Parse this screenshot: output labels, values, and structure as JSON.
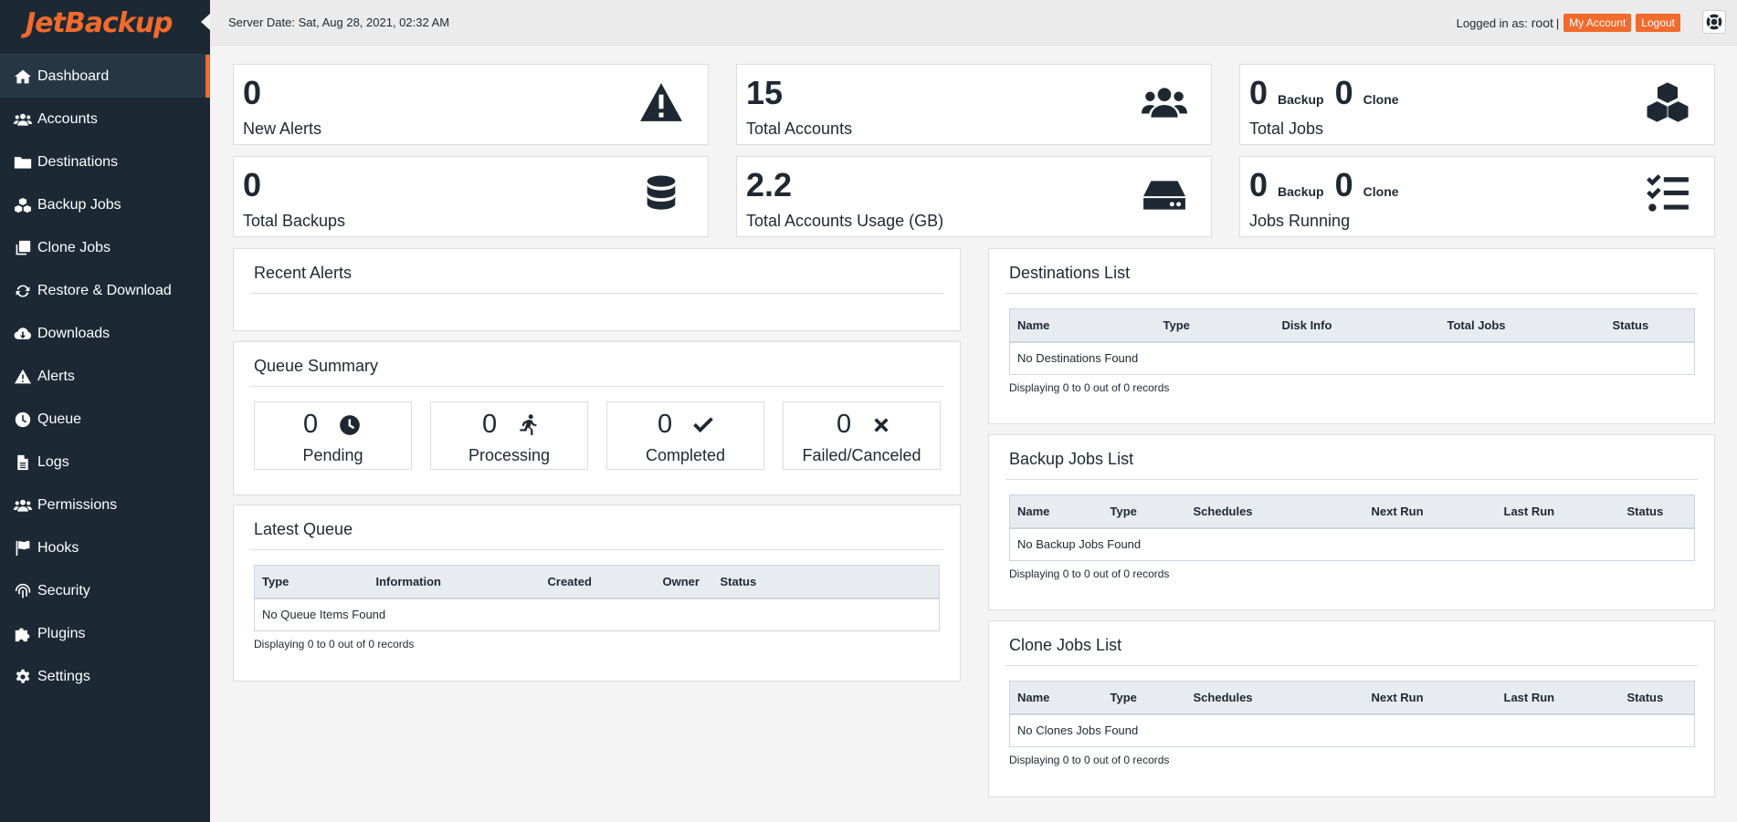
{
  "brand": {
    "logo": "JetBackup",
    "accent": "#f26b2c"
  },
  "sidebar": {
    "items": [
      {
        "label": "Dashboard",
        "icon": "home-icon",
        "active": true
      },
      {
        "label": "Accounts",
        "icon": "users-icon"
      },
      {
        "label": "Destinations",
        "icon": "folder-icon"
      },
      {
        "label": "Backup Jobs",
        "icon": "cubes-icon"
      },
      {
        "label": "Clone Jobs",
        "icon": "copy-icon"
      },
      {
        "label": "Restore & Download",
        "icon": "sync-icon"
      },
      {
        "label": "Downloads",
        "icon": "cloud-download-icon"
      },
      {
        "label": "Alerts",
        "icon": "warning-icon"
      },
      {
        "label": "Queue",
        "icon": "clock-icon"
      },
      {
        "label": "Logs",
        "icon": "file-icon"
      },
      {
        "label": "Permissions",
        "icon": "users-icon"
      },
      {
        "label": "Hooks",
        "icon": "flag-icon"
      },
      {
        "label": "Security",
        "icon": "fingerprint-icon"
      },
      {
        "label": "Plugins",
        "icon": "puzzle-icon"
      },
      {
        "label": "Settings",
        "icon": "gear-icon"
      }
    ]
  },
  "topbar": {
    "server_date": "Server Date: Sat, Aug 28, 2021, 02:32 AM",
    "logged_in_prefix": "Logged in as:",
    "user": "root",
    "separator": "|",
    "my_account": "My Account",
    "logout": "Logout"
  },
  "stats": {
    "new_alerts": {
      "value": "0",
      "label": "New Alerts"
    },
    "total_accounts": {
      "value": "15",
      "label": "Total Accounts"
    },
    "total_jobs": {
      "backup_value": "0",
      "backup_label": "Backup",
      "clone_value": "0",
      "clone_label": "Clone",
      "label": "Total Jobs"
    },
    "total_backups": {
      "value": "0",
      "label": "Total Backups"
    },
    "accounts_usage": {
      "value": "2.2",
      "label": "Total Accounts Usage (GB)"
    },
    "jobs_running": {
      "backup_value": "0",
      "backup_label": "Backup",
      "clone_value": "0",
      "clone_label": "Clone",
      "label": "Jobs Running"
    }
  },
  "recent_alerts": {
    "title": "Recent Alerts"
  },
  "queue_summary": {
    "title": "Queue Summary",
    "pending": {
      "value": "0",
      "label": "Pending"
    },
    "processing": {
      "value": "0",
      "label": "Processing"
    },
    "completed": {
      "value": "0",
      "label": "Completed"
    },
    "failed": {
      "value": "0",
      "label": "Failed/Canceled"
    }
  },
  "latest_queue": {
    "title": "Latest Queue",
    "columns": [
      "Type",
      "Information",
      "Created",
      "Owner",
      "Status"
    ],
    "empty": "No Queue Items Found",
    "records": "Displaying 0 to 0 out of 0 records"
  },
  "destinations_list": {
    "title": "Destinations List",
    "columns": [
      "Name",
      "Type",
      "Disk Info",
      "Total Jobs",
      "Status"
    ],
    "empty": "No Destinations Found",
    "records": "Displaying 0 to 0 out of 0 records"
  },
  "backup_jobs_list": {
    "title": "Backup Jobs List",
    "columns": [
      "Name",
      "Type",
      "Schedules",
      "Next Run",
      "Last Run",
      "Status"
    ],
    "empty": "No Backup Jobs Found",
    "records": "Displaying 0 to 0 out of 0 records"
  },
  "clone_jobs_list": {
    "title": "Clone Jobs List",
    "columns": [
      "Name",
      "Type",
      "Schedules",
      "Next Run",
      "Last Run",
      "Status"
    ],
    "empty": "No Clones Jobs Found",
    "records": "Displaying 0 to 0 out of 0 records"
  }
}
